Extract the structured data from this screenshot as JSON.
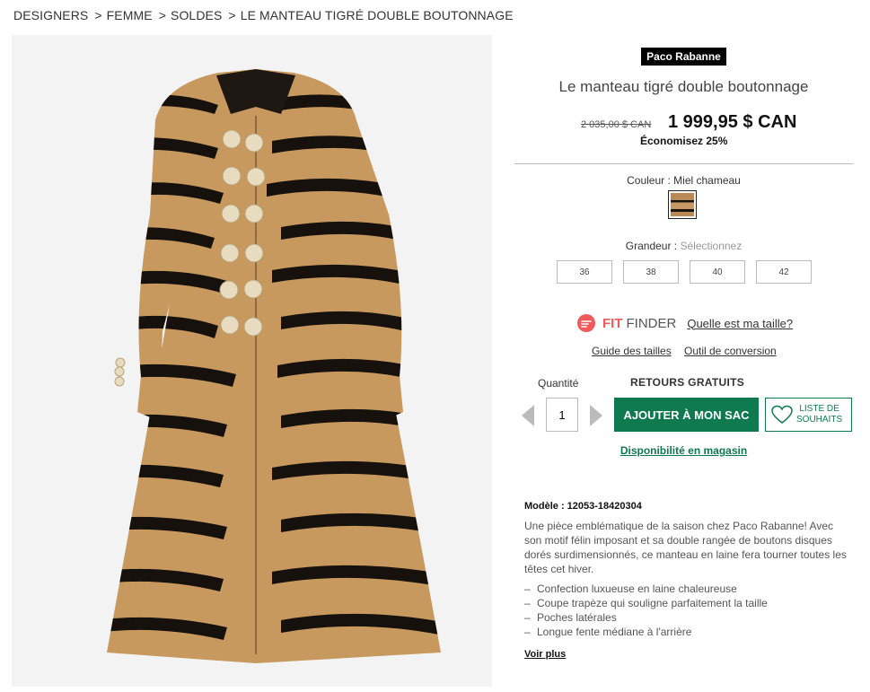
{
  "breadcrumb": [
    {
      "label": "DESIGNERS"
    },
    {
      "label": "FEMME"
    },
    {
      "label": "SOLDES"
    },
    {
      "label": "LE MANTEAU TIGRÉ DOUBLE BOUTONNAGE"
    }
  ],
  "product": {
    "brand": "Paco Rabanne",
    "title": "Le manteau tigré double boutonnage",
    "price_old": "2 035,00 $ CAN",
    "price_now": "1 999,95 $ CAN",
    "saving": "Économisez 25%",
    "color_label": "Couleur : Miel chameau",
    "size_label": "Grandeur :",
    "size_placeholder": "Sélectionnez",
    "sizes": [
      "36",
      "38",
      "40",
      "42"
    ],
    "image_icon": "tiger-coat-photo"
  },
  "fit_finder": {
    "brand_strong": "FIT",
    "brand_light": "FINDER",
    "link": "Quelle est ma taille?",
    "guide": "Guide des tailles",
    "conversion": "Outil de conversion",
    "icon": "fit-finder-icon"
  },
  "purchase": {
    "qty_label": "Quantité",
    "qty_value": "1",
    "returns": "RETOURS GRATUITS",
    "add_to_bag": "AJOUTER À MON SAC",
    "wishlist_line1": "LISTE DE",
    "wishlist_line2": "SOUHAITS",
    "store_availability": "Disponibilité en magasin",
    "accent_color": "#0f7a4f"
  },
  "details": {
    "model": "Modèle : 12053-18420304",
    "description": "Une pièce emblématique de la saison chez Paco Rabanne! Avec son motif félin imposant et sa double rangée de boutons disques dorés surdimensionnés, ce manteau en laine fera tourner toutes les têtes cet hiver.",
    "bullets": [
      "Confection luxueuse en laine chaleureuse",
      "Coupe trapèze qui souligne parfaitement la taille",
      "Poches latérales",
      "Longue fente médiane à l'arrière"
    ],
    "more": "Voir plus"
  }
}
